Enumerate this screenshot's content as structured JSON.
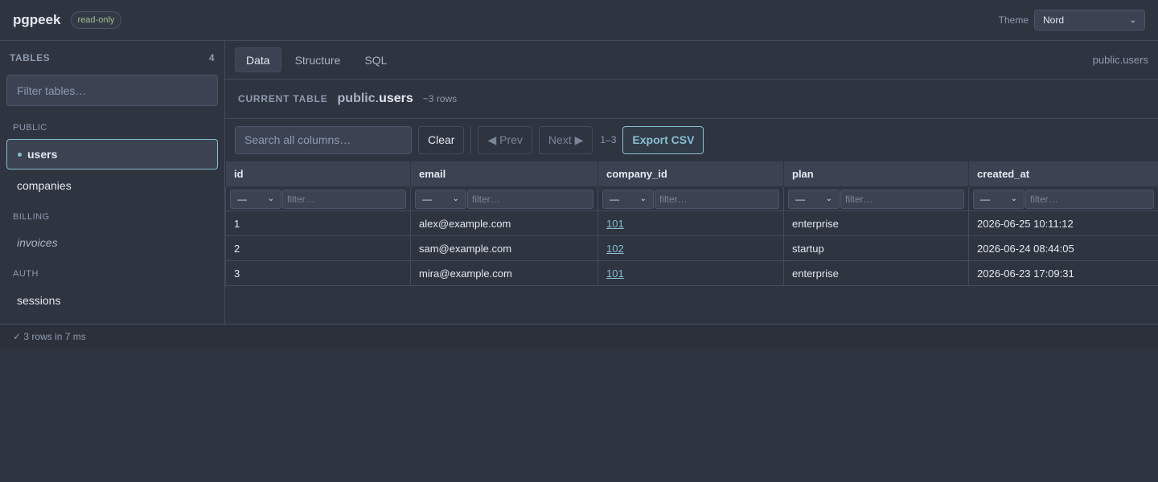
{
  "header": {
    "app_title": "pgpeek",
    "badge": "read-only",
    "theme_label": "Theme",
    "theme_value": "Nord"
  },
  "sidebar": {
    "heading": "TABLES",
    "count": "4",
    "filter_placeholder": "Filter tables…",
    "groups": [
      {
        "label": "PUBLIC",
        "items": [
          {
            "label": "users",
            "active": true
          },
          {
            "label": "companies"
          }
        ]
      },
      {
        "label": "BILLING",
        "items": [
          {
            "label": "invoices",
            "italic": true
          }
        ]
      },
      {
        "label": "AUTH",
        "items": [
          {
            "label": "sessions"
          }
        ]
      }
    ]
  },
  "tabs": [
    {
      "label": "Data",
      "active": true
    },
    {
      "label": "Structure"
    },
    {
      "label": "SQL"
    }
  ],
  "tab_crumb": "public.users",
  "current_table": {
    "label": "CURRENT TABLE",
    "schema": "public",
    "separator": ".",
    "name": "users",
    "rows": "~3 rows"
  },
  "toolbar": {
    "search_placeholder": "Search all columns…",
    "clear_label": "Clear",
    "prev_label": "◀ Prev",
    "next_label": "Next ▶",
    "range": "1–3",
    "export_label": "Export CSV"
  },
  "table": {
    "columns": [
      "id",
      "email",
      "company_id",
      "plan",
      "created_at"
    ],
    "filter_op": "—",
    "filter_placeholder": "filter…",
    "rows": [
      [
        "1",
        "alex@example.com",
        "101",
        "enterprise",
        "2026-06-25 10:11:12"
      ],
      [
        "2",
        "sam@example.com",
        "102",
        "startup",
        "2026-06-24 08:44:05"
      ],
      [
        "3",
        "mira@example.com",
        "101",
        "enterprise",
        "2026-06-23 17:09:31"
      ]
    ]
  },
  "status": "✓ 3 rows in 7 ms",
  "colors": {
    "background": "#2e3440",
    "accent": "#88c0d0",
    "badge": "#a3be8c"
  }
}
